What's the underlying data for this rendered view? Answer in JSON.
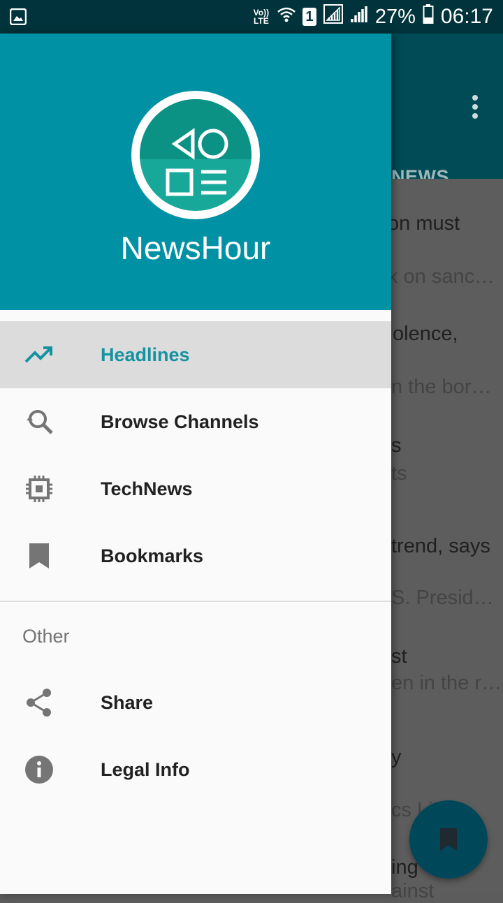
{
  "status_bar": {
    "network_type": "Vo)) LTE",
    "sim": "1",
    "battery": "27%",
    "time": "06:17"
  },
  "background_app": {
    "tab_partial": "CHNEWS",
    "stories": [
      {
        "title": "on must",
        "sub": "k on sanc…"
      },
      {
        "title": "olence,",
        "sub": "n the bor…"
      },
      {
        "title": "s",
        "sub": "ts"
      },
      {
        "title": "trend, says",
        "sub": "S. Presid…"
      },
      {
        "title": "st",
        "sub": "en in the r…"
      },
      {
        "title": "y",
        "sub": "cs Li"
      },
      {
        "title": "ing",
        "sub": "ainst"
      }
    ]
  },
  "drawer": {
    "app_name": "NewsHour",
    "items": [
      {
        "label": "Headlines",
        "icon": "trending-up-icon"
      },
      {
        "label": "Browse Channels",
        "icon": "browse-search-icon"
      },
      {
        "label": "TechNews",
        "icon": "chip-icon"
      },
      {
        "label": "Bookmarks",
        "icon": "bookmark-icon"
      }
    ],
    "section_other": "Other",
    "other_items": [
      {
        "label": "Share",
        "icon": "share-icon"
      },
      {
        "label": "Legal Info",
        "icon": "info-icon"
      }
    ]
  },
  "colors": {
    "accent": "#0092a4",
    "active_label": "#1592a0",
    "status_bar": "#00333b"
  }
}
